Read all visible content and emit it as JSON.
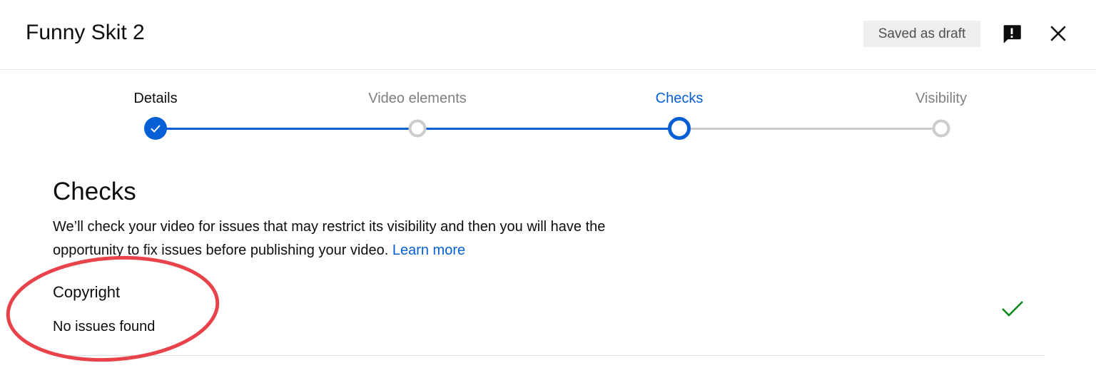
{
  "header": {
    "title": "Funny Skit 2",
    "draft_status": "Saved as draft",
    "feedback_icon": "feedback-icon",
    "close_icon": "close-icon"
  },
  "stepper": {
    "steps": [
      {
        "label": "Details",
        "state": "done"
      },
      {
        "label": "Video elements",
        "state": "done"
      },
      {
        "label": "Checks",
        "state": "active"
      },
      {
        "label": "Visibility",
        "state": "pending"
      }
    ]
  },
  "checks": {
    "title": "Checks",
    "description": "We’ll check your video for issues that may restrict its visibility and then you will have the opportunity to fix issues before publishing your video.",
    "learn_more": "Learn more",
    "copyright": {
      "title": "Copyright",
      "status": "No issues found",
      "status_icon": "checkmark-icon"
    }
  },
  "colors": {
    "accent": "#065fd4",
    "success": "#0f8a1c",
    "annotation": "#e8434a",
    "grey_track": "#cccccc"
  }
}
